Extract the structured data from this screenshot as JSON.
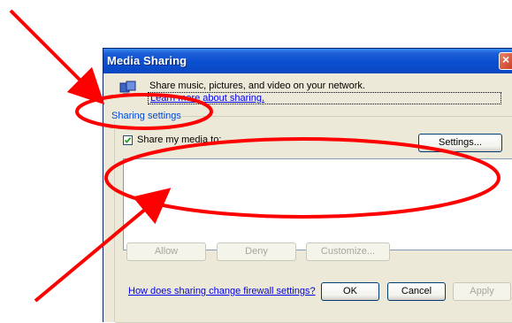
{
  "window": {
    "title": "Media Sharing",
    "description": "Share music, pictures, and video on your network.",
    "learn_link": "Learn more about sharing.",
    "group_label": "Sharing settings",
    "share_checkbox_label": "Share my media to:",
    "share_checked": true,
    "settings_button": "Settings...",
    "allow_button": "Allow",
    "deny_button": "Deny",
    "customize_button": "Customize...",
    "firewall_link": "How does sharing change firewall settings?",
    "ok_button": "OK",
    "cancel_button": "Cancel",
    "apply_button": "Apply"
  },
  "annotation": {
    "color": "#ff0000"
  },
  "icons": {
    "close": "close-icon",
    "media_sharing": "media-sharing-icon",
    "checkmark": "checkmark-icon"
  }
}
